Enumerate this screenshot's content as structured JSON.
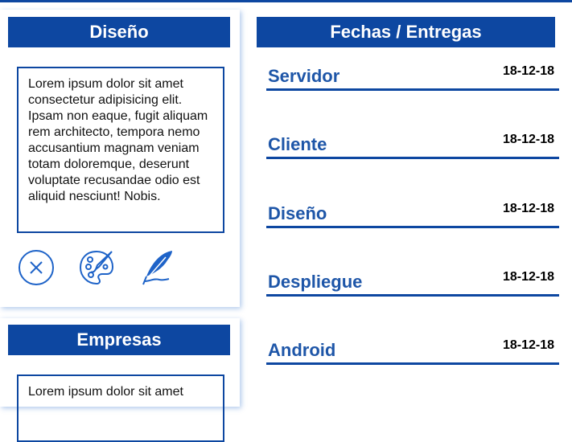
{
  "colors": {
    "accent": "#0d47a1",
    "task_name": "#1e56a8",
    "shadow": "#90b8ee"
  },
  "cards": [
    {
      "title": "Diseño",
      "text": "Lorem ipsum dolor sit amet consectetur adipisicing elit. Ipsam non eaque, fugit aliquam rem architecto, tempora nemo accusantium magnam veniam totam doloremque, deserunt voluptate recusandae odio est aliquid nesciunt! Nobis.",
      "icons": [
        "close-circle-icon",
        "palette-icon",
        "feather-quill-icon"
      ]
    },
    {
      "title": "Empresas",
      "text": "Lorem ipsum dolor sit amet"
    }
  ],
  "deadlines": {
    "title": "Fechas / Entregas",
    "items": [
      {
        "name": "Servidor",
        "date": "18-12-18"
      },
      {
        "name": "Cliente",
        "date": "18-12-18"
      },
      {
        "name": "Diseño",
        "date": "18-12-18"
      },
      {
        "name": "Despliegue",
        "date": "18-12-18"
      },
      {
        "name": "Android",
        "date": "18-12-18"
      }
    ]
  }
}
